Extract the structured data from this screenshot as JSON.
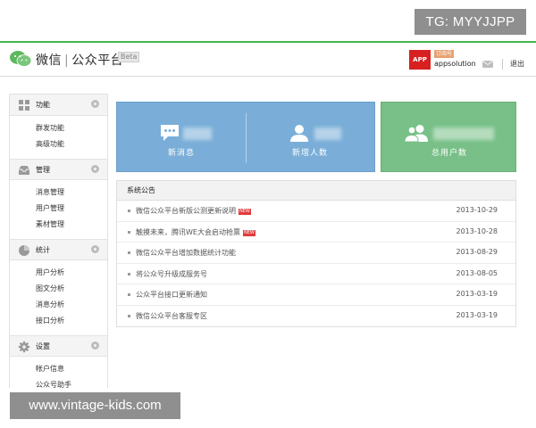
{
  "watermarks": {
    "top": "TG: MYYJJPP",
    "bottom": "www.vintage-kids.com"
  },
  "header": {
    "brand_main": "微信",
    "brand_sep": "|",
    "brand_sub": "公众平台",
    "beta": "Beta",
    "avatar_text": "APP",
    "sub_badge": "订阅号",
    "account_name": "appsolution",
    "logout": "退出",
    "accent_color": "#44b549"
  },
  "sidebar": {
    "groups": [
      {
        "label": "功能",
        "icon": "grid-icon",
        "items": [
          "群发功能",
          "高级功能"
        ]
      },
      {
        "label": "管理",
        "icon": "inbox-icon",
        "items": [
          "消息管理",
          "用户管理",
          "素材管理"
        ]
      },
      {
        "label": "统计",
        "icon": "pie-chart-icon",
        "items": [
          "用户分析",
          "图文分析",
          "消息分析",
          "接口分析"
        ]
      },
      {
        "label": "设置",
        "icon": "gear-icon",
        "items": [
          "帐户信息",
          "公众号助手"
        ]
      }
    ]
  },
  "stats": {
    "new_messages_label": "新消息",
    "new_followers_label": "新增人数",
    "total_users_label": "总用户数",
    "blue_color": "#7aaed8",
    "green_color": "#78c088"
  },
  "notice": {
    "title": "系统公告",
    "rows": [
      {
        "title": "微信公众平台新版公测更新说明",
        "new": "NEW",
        "date": "2013-10-29"
      },
      {
        "title": "触摸未来，腾讯WE大会启动抢票",
        "new": "NEW",
        "date": "2013-10-28"
      },
      {
        "title": "微信公众平台增加数据统计功能",
        "new": "",
        "date": "2013-08-29"
      },
      {
        "title": "将公众号升级成服务号",
        "new": "",
        "date": "2013-08-05"
      },
      {
        "title": "公众平台接口更新通知",
        "new": "",
        "date": "2013-03-19"
      },
      {
        "title": "微信公众平台客服专区",
        "new": "",
        "date": "2013-03-19"
      }
    ]
  }
}
